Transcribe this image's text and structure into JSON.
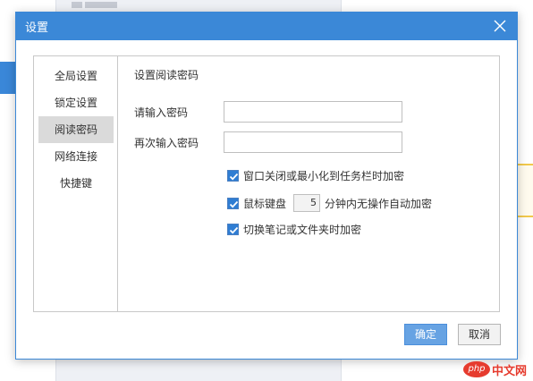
{
  "dialog": {
    "title": "设置",
    "close_icon": "close-icon"
  },
  "nav": {
    "items": [
      {
        "label": "全局设置",
        "active": false
      },
      {
        "label": "锁定设置",
        "active": false
      },
      {
        "label": "阅读密码",
        "active": true
      },
      {
        "label": "网络连接",
        "active": false
      },
      {
        "label": "快捷键",
        "active": false
      }
    ]
  },
  "content": {
    "section_title": "设置阅读密码",
    "password_label": "请输入密码",
    "password_value": "",
    "confirm_label": "再次输入密码",
    "confirm_value": "",
    "option_minimize": {
      "label": "窗口关闭或最小化到任务栏时加密",
      "checked": true
    },
    "option_idle": {
      "label_before": "鼠标键盘",
      "minutes": "5",
      "label_after": "分钟内无操作自动加密",
      "checked": true
    },
    "option_switch": {
      "label": "切换笔记或文件夹时加密",
      "checked": true
    }
  },
  "buttons": {
    "ok": "确定",
    "cancel": "取消"
  },
  "watermark": {
    "logo": "php",
    "text": "中文网"
  },
  "colors": {
    "title_bar": "#3b88d7",
    "ok_button": "#67a3e3",
    "nav_active": "#dadada",
    "checkbox": "#2f7dd3"
  }
}
